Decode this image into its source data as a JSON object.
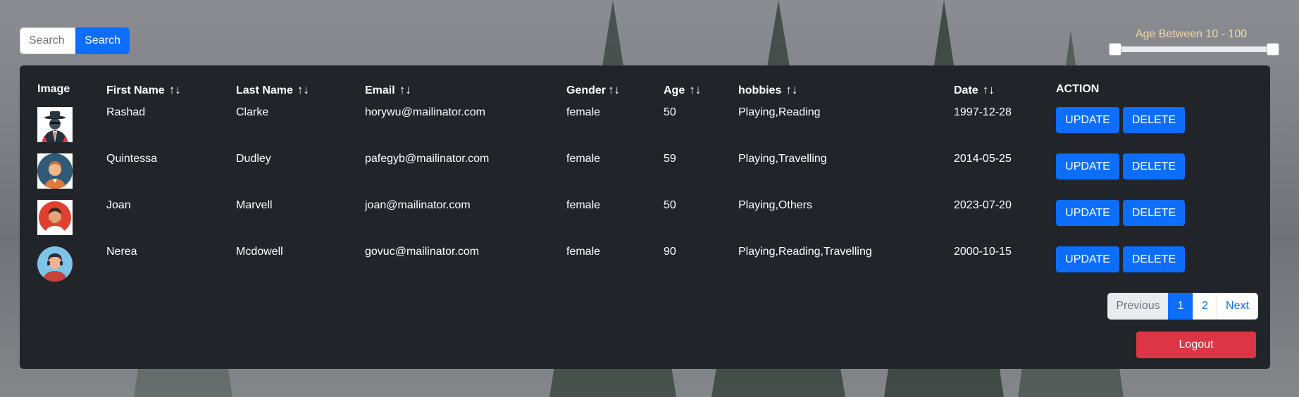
{
  "search": {
    "placeholder": "Search",
    "button_label": "Search"
  },
  "age_filter": {
    "label": "Age Between 10 - 100",
    "min": 10,
    "max": 100
  },
  "table": {
    "headers": [
      "Image",
      "First Name",
      "Last Name",
      "Email",
      "Gender",
      "Age",
      "hobbies",
      "Date",
      "ACTION"
    ],
    "sort_glyph": "↑↓",
    "rows": [
      {
        "avatar": "man-in-hat-avatar",
        "first": "Rashad",
        "last": "Clarke",
        "email": "horywu@mailinator.com",
        "gender": "female",
        "age": "50",
        "hobbies": "Playing,Reading",
        "date": "1997-12-28"
      },
      {
        "avatar": "bearded-man-avatar",
        "first": "Quintessa",
        "last": "Dudley",
        "email": "pafegyb@mailinator.com",
        "gender": "female",
        "age": "59",
        "hobbies": "Playing,Travelling",
        "date": "2014-05-25"
      },
      {
        "avatar": "red-background-man-avatar",
        "first": "Joan",
        "last": "Marvell",
        "email": "joan@mailinator.com",
        "gender": "female",
        "age": "50",
        "hobbies": "Playing,Others",
        "date": "2023-07-20"
      },
      {
        "avatar": "student-avatar",
        "first": "Nerea",
        "last": "Mcdowell",
        "email": "govuc@mailinator.com",
        "gender": "female",
        "age": "90",
        "hobbies": "Playing,Reading,Travelling",
        "date": "2000-10-15"
      }
    ],
    "update_label": "UPDATE",
    "delete_label": "DELETE"
  },
  "pagination": {
    "previous": "Previous",
    "pages": [
      "1",
      "2"
    ],
    "next": "Next",
    "current": "1"
  },
  "logout_label": "Logout",
  "colors": {
    "primary": "#0d6efd",
    "danger": "#dc3545",
    "card": "#212529",
    "slider_label": "#f2d9a6"
  }
}
